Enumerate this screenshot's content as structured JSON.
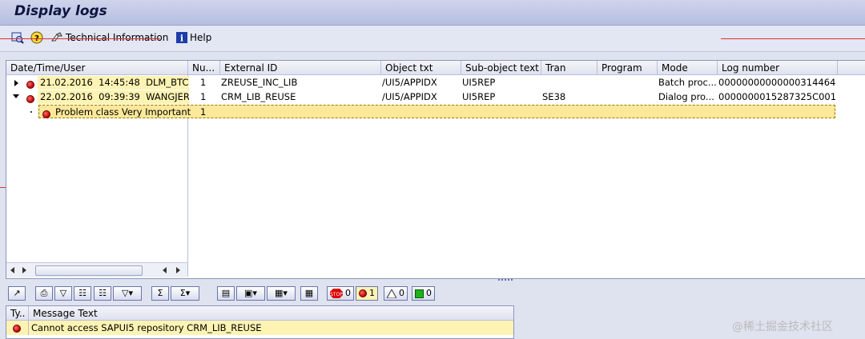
{
  "window": {
    "title": "Display logs"
  },
  "toolbar": {
    "technical_info_label": "Technical Information",
    "help_label": "Help"
  },
  "log_table": {
    "columns": [
      "Date/Time/User",
      "Nu...",
      "External ID",
      "Object txt",
      "Sub-object text",
      "Tran",
      "Program",
      "Mode",
      "Log number"
    ],
    "rows": [
      {
        "date": "21.02.2016",
        "time": "14:45:48",
        "user": "DLM_BTC",
        "num": "1",
        "external_id": "ZREUSE_INC_LIB",
        "object": "/UI5/APPIDX",
        "subobject": "UI5REP",
        "tran": "",
        "program": "",
        "mode": "Batch proc...",
        "log_number": "00000000000000314464"
      },
      {
        "date": "22.02.2016",
        "time": "09:39:39",
        "user": "WANGJER",
        "num": "1",
        "external_id": "CRM_LIB_REUSE",
        "object": "/UI5/APPIDX",
        "subobject": "UI5REP",
        "tran": "SE38",
        "program": "",
        "mode": "Dialog pro...",
        "log_number": "0000000015287325C001"
      }
    ],
    "child_row": {
      "label": "Problem class Very Important",
      "num": "1"
    }
  },
  "message_toolbar": {
    "counts": {
      "stop": "0",
      "error": "1",
      "warning": "0",
      "success": "0"
    }
  },
  "messages": {
    "columns": [
      "Ty..",
      "Message Text"
    ],
    "rows": [
      {
        "text": "Cannot access SAPUI5 repository CRM_LIB_REUSE"
      }
    ]
  },
  "watermark": "@稀土掘金技术社区"
}
